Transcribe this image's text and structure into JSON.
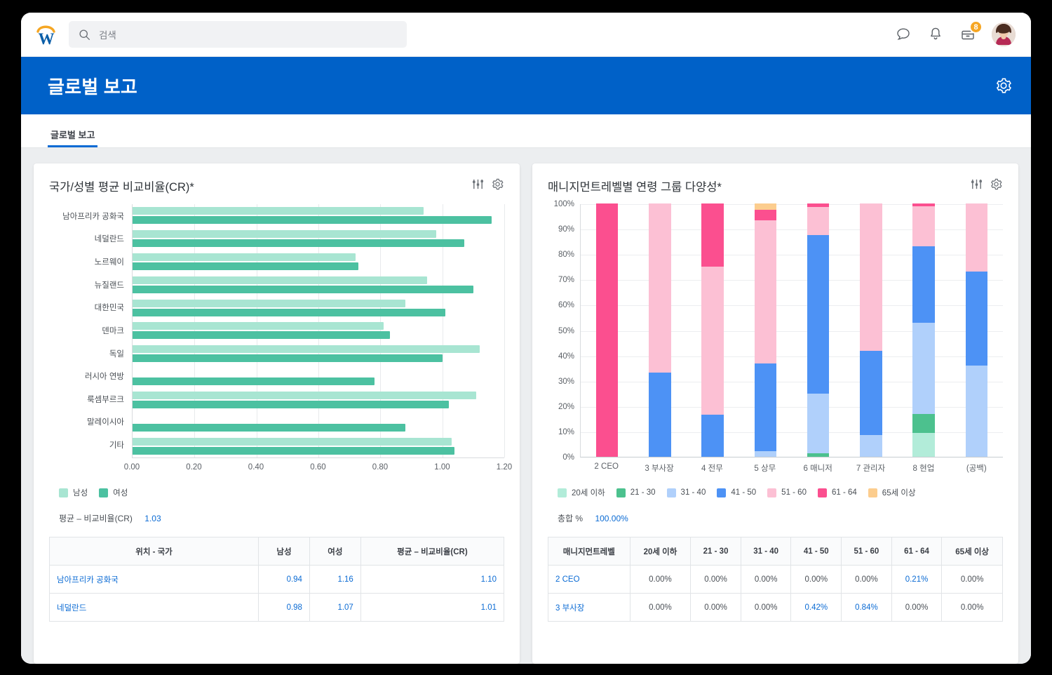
{
  "topbar": {
    "logo_name": "workday-logo",
    "search": {
      "placeholder": "검색",
      "value": ""
    },
    "icons": [
      {
        "name": "chat-icon",
        "label": "채팅"
      },
      {
        "name": "bell-icon",
        "label": "알림"
      },
      {
        "name": "inbox-icon",
        "label": "받은편지함",
        "badge": "8"
      }
    ],
    "avatar_label": "프로필"
  },
  "banner": {
    "title": "글로벌 보고",
    "gear_label": "설정"
  },
  "tabs": [
    {
      "label": "글로벌 보고",
      "active": true
    }
  ],
  "colors": {
    "banner_blue": "#0061c8",
    "link_blue": "#0b6bd4",
    "male_green": "#a8e5d2",
    "female_green": "#4cc1a1",
    "age_under20": "#b2ecd9",
    "age_21_30": "#4cc18e",
    "age_31_40": "#b0d0fb",
    "age_41_50": "#4d92f5",
    "age_51_60": "#fcc0d4",
    "age_61_64": "#fb4f8f",
    "age_65plus": "#fccd8e"
  },
  "left_card": {
    "title": "국가/성별 평균 비교비율(CR)*",
    "filter_icon": "sliders-icon",
    "gear_icon": "gear-icon",
    "legend": [
      {
        "label": "남성",
        "color": "#a8e5d2"
      },
      {
        "label": "여성",
        "color": "#4cc1a1"
      }
    ],
    "summary_label": "평균 – 비교비율(CR)",
    "summary_value": "1.03",
    "table": {
      "headers": [
        "위치 - 국가",
        "남성",
        "여성",
        "평균 – 비교비율(CR)"
      ],
      "rows": [
        {
          "country": "남아프리카 공화국",
          "male": "0.94",
          "female": "1.16",
          "avg": "1.10"
        },
        {
          "country": "네덜란드",
          "male": "0.98",
          "female": "1.07",
          "avg": "1.01"
        }
      ]
    }
  },
  "right_card": {
    "title": "매니지먼트레벨별 연령 그룹 다양성*",
    "filter_icon": "sliders-icon",
    "gear_icon": "gear-icon",
    "legend": [
      {
        "label": "20세 이하",
        "color": "#b2ecd9"
      },
      {
        "label": "21 - 30",
        "color": "#4cc18e"
      },
      {
        "label": "31 - 40",
        "color": "#b0d0fb"
      },
      {
        "label": "41 - 50",
        "color": "#4d92f5"
      },
      {
        "label": "51 - 60",
        "color": "#fcc0d4"
      },
      {
        "label": "61 - 64",
        "color": "#fb4f8f"
      },
      {
        "label": "65세 이상",
        "color": "#fccd8e"
      }
    ],
    "summary_label": "총합 %",
    "summary_value": "100.00%",
    "table": {
      "headers": [
        "매니지먼트레벨",
        "20세 이하",
        "21 - 30",
        "31 - 40",
        "41 - 50",
        "51 - 60",
        "61 - 64",
        "65세 이상"
      ],
      "rows": [
        {
          "level": "2 CEO",
          "cells": [
            "0.00%",
            "0.00%",
            "0.00%",
            "0.00%",
            "0.00%",
            "0.21%",
            "0.00%"
          ],
          "link_cells": [
            5
          ]
        },
        {
          "level": "3 부사장",
          "cells": [
            "0.00%",
            "0.00%",
            "0.00%",
            "0.42%",
            "0.84%",
            "0.00%",
            "0.00%"
          ],
          "link_cells": [
            3,
            4
          ]
        }
      ]
    }
  },
  "chart_data": [
    {
      "type": "bar",
      "orientation": "horizontal",
      "title": "국가/성별 평균 비교비율(CR)*",
      "xlabel": "",
      "ylabel": "",
      "xlim": [
        0,
        1.2
      ],
      "xticks": [
        "0.00",
        "0.20",
        "0.40",
        "0.60",
        "0.80",
        "1.00",
        "1.20"
      ],
      "grid": true,
      "legend_position": "bottom-left",
      "categories": [
        "남아프리카 공화국",
        "네덜란드",
        "노르웨이",
        "뉴질랜드",
        "대한민국",
        "덴마크",
        "독일",
        "러시아 연방",
        "룩셈부르크",
        "말레이시아",
        "기타"
      ],
      "series": [
        {
          "name": "남성",
          "color": "#a8e5d2",
          "values": [
            0.94,
            0.98,
            0.72,
            0.95,
            0.88,
            0.81,
            1.12,
            null,
            1.11,
            null,
            1.03
          ]
        },
        {
          "name": "여성",
          "color": "#4cc1a1",
          "values": [
            1.16,
            1.07,
            0.73,
            1.1,
            1.01,
            0.83,
            1.0,
            0.78,
            1.02,
            0.88,
            1.04
          ]
        }
      ],
      "average_line_label": "평균 – 비교비율(CR)",
      "average_value": 1.03
    },
    {
      "type": "bar",
      "orientation": "vertical",
      "stacked": true,
      "title": "매니지먼트레벨별 연령 그룹 다양성*",
      "xlabel": "",
      "ylabel": "",
      "ylim": [
        0,
        100
      ],
      "yticks": [
        "0%",
        "10%",
        "20%",
        "30%",
        "40%",
        "50%",
        "60%",
        "70%",
        "80%",
        "90%",
        "100%"
      ],
      "grid": true,
      "legend_position": "bottom",
      "categories": [
        "2 CEO",
        "3 부사장",
        "4 전무",
        "5 상무",
        "6 매니저",
        "7 관리자",
        "8 현업",
        "(공백)"
      ],
      "series": [
        {
          "name": "20세 이하",
          "color": "#b2ecd9",
          "values": [
            0,
            0,
            0,
            0,
            0,
            0,
            9.5,
            0
          ]
        },
        {
          "name": "21 - 30",
          "color": "#4cc18e",
          "values": [
            0,
            0,
            0,
            0,
            1.5,
            0,
            7.5,
            0
          ]
        },
        {
          "name": "31 - 40",
          "color": "#b0d0fb",
          "values": [
            0,
            0,
            0,
            2.2,
            23.5,
            8.5,
            36.0,
            36.0
          ]
        },
        {
          "name": "41 - 50",
          "color": "#4d92f5",
          "values": [
            0,
            33.3,
            16.7,
            34.6,
            62.5,
            33.3,
            30.0,
            37.0
          ]
        },
        {
          "name": "51 - 60",
          "color": "#fcc0d4",
          "values": [
            0,
            66.7,
            58.3,
            56.6,
            11.0,
            58.2,
            16.0,
            27.0
          ]
        },
        {
          "name": "61 - 64",
          "color": "#fb4f8f",
          "values": [
            100,
            0,
            25.0,
            4.1,
            1.5,
            0,
            1.0,
            0
          ]
        },
        {
          "name": "65세 이상",
          "color": "#fccd8e",
          "values": [
            0,
            0,
            0,
            2.5,
            0,
            0,
            0,
            0
          ]
        }
      ],
      "total_label": "총합 %",
      "total_value": "100.00%"
    }
  ]
}
